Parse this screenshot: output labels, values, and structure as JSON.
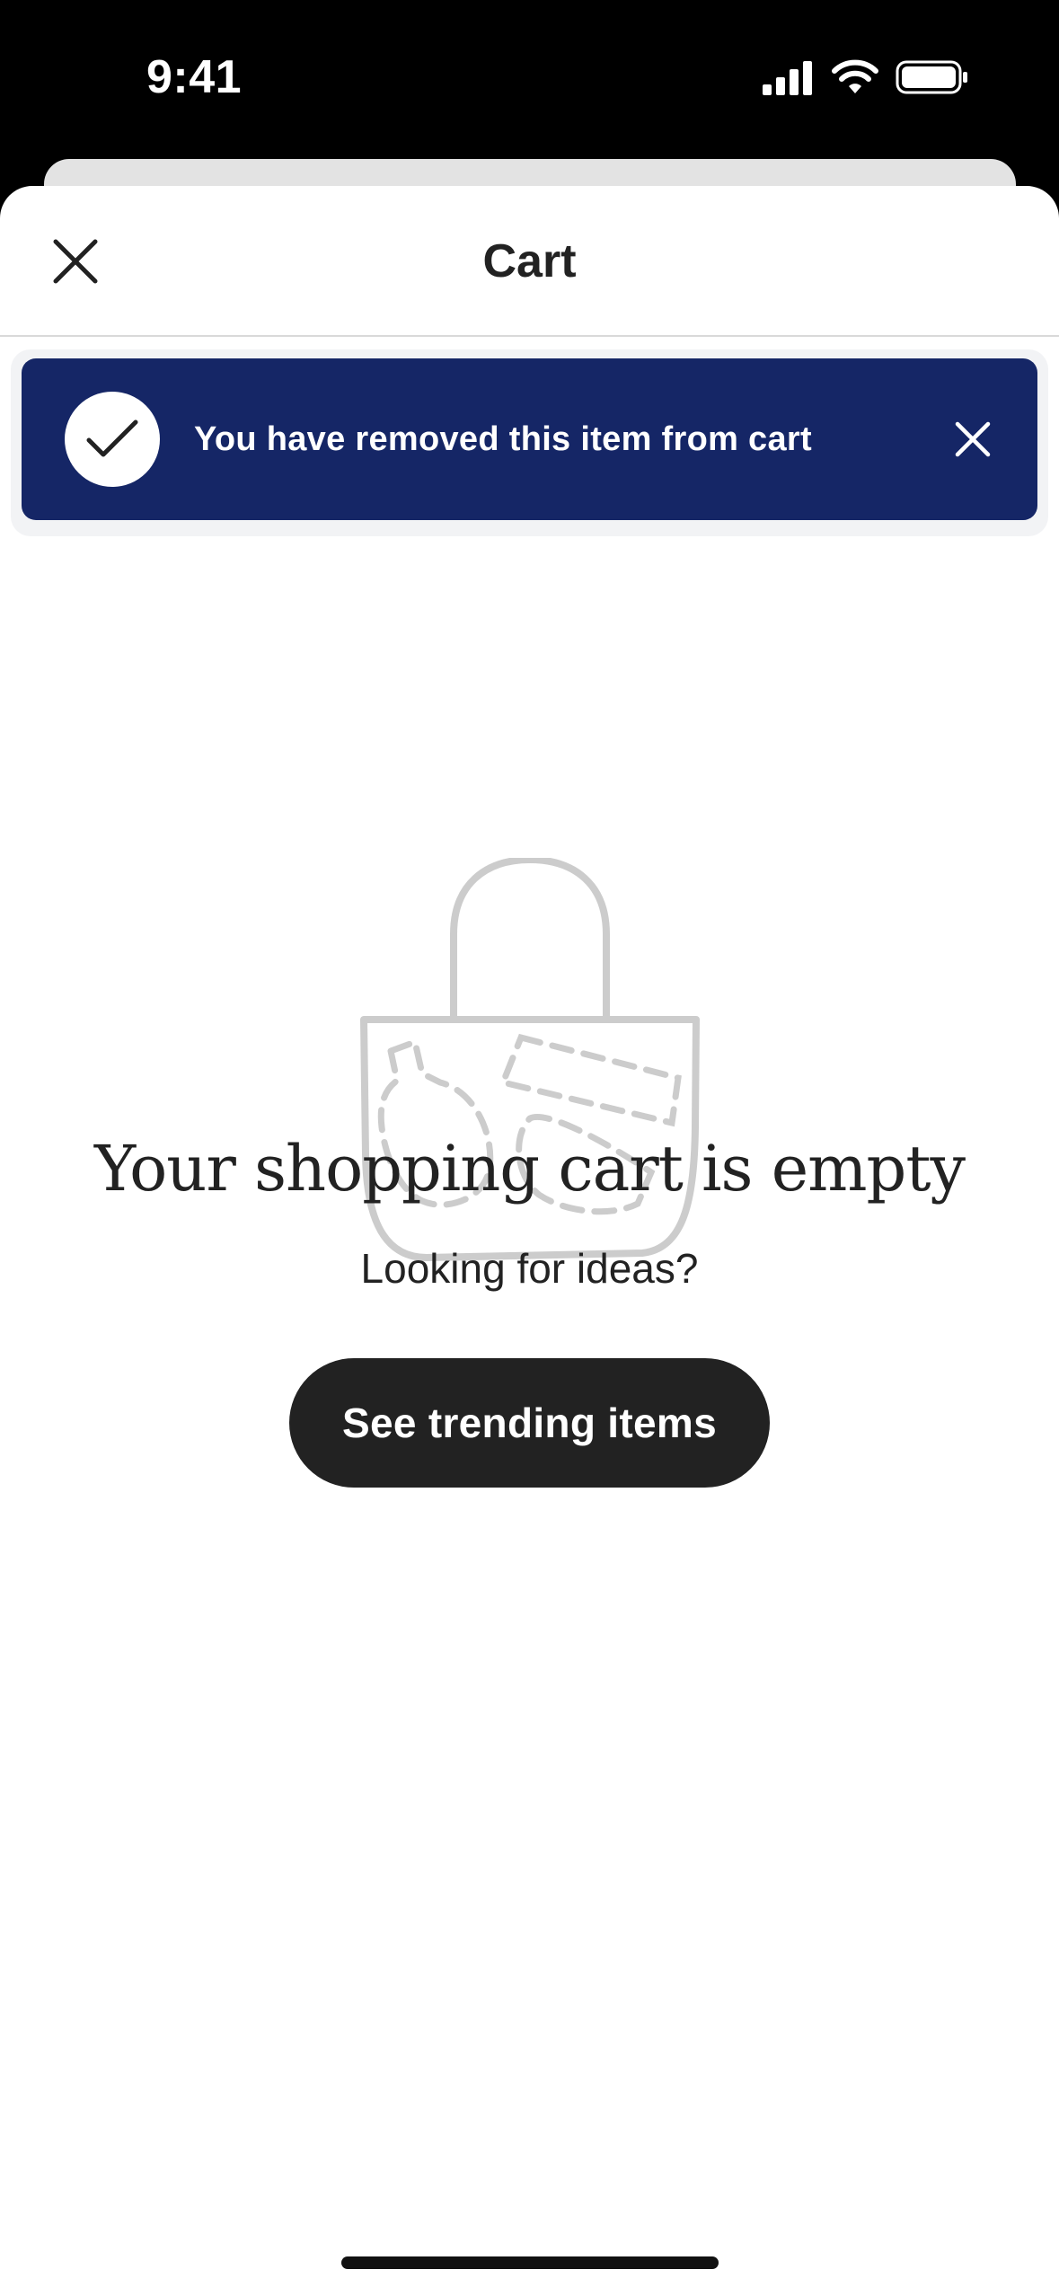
{
  "status_bar": {
    "time": "9:41",
    "icons": [
      "cellular-signal-icon",
      "wifi-icon",
      "battery-icon"
    ]
  },
  "header": {
    "title": "Cart",
    "close_icon": "close-icon"
  },
  "toast": {
    "message": "You have removed this item from cart",
    "icon": "checkmark-icon",
    "dismiss_icon": "close-icon",
    "background_color": "#152666"
  },
  "empty_state": {
    "illustration": "shopping-bag-icon",
    "title": "Your shopping cart is empty",
    "subtitle": "Looking for ideas?",
    "cta_label": "See trending items"
  },
  "colors": {
    "primary_text": "#222222",
    "button_bg": "#222222",
    "illustration_stroke": "#cccccc"
  }
}
